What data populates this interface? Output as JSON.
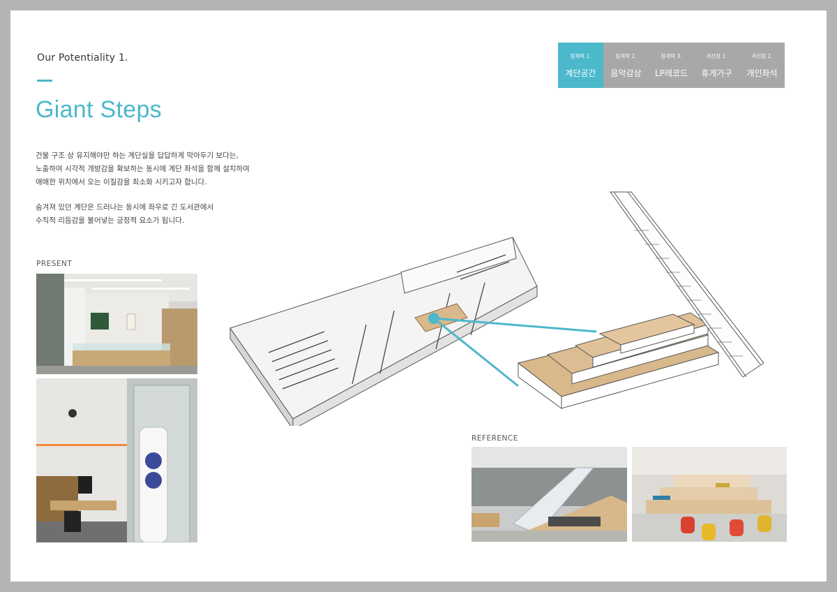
{
  "eyebrow": "Our Potentiality 1.",
  "title": "Giant Steps",
  "description": {
    "paragraph1": [
      "건물 구조 상 유지해야만 하는 계단실을 답답하게 막아두기 보다는,",
      "노출하여 시각적 개방감을 확보하는 동시에 계단 좌석을 함께 설치하여",
      "애매한 위치에서 오는 이질감을 최소화 시키고자 합니다."
    ],
    "paragraph2": [
      "숨겨져 있던 계단은 드러나는 동시에 좌우로 긴 도서관에서",
      "수직적 리듬감을 불어넣는 긍정적 요소가 됩니다."
    ]
  },
  "labels": {
    "present": "PRESENT",
    "reference": "REFERENCE"
  },
  "tabs": [
    {
      "category": "잠재력 1.",
      "name": "계단공간",
      "active": true
    },
    {
      "category": "잠재력 2.",
      "name": "음악감상",
      "active": false
    },
    {
      "category": "잠재력 3.",
      "name": "LP레코드",
      "active": false
    },
    {
      "category": "개선점 1.",
      "name": "휴게가구",
      "active": false
    },
    {
      "category": "개선점 2.",
      "name": "개인좌석",
      "active": false
    }
  ],
  "colors": {
    "accent": "#4bb8cb",
    "tab_inactive": "#a8a8a8",
    "frame": "#b4b4b4",
    "wood": "#d9b88c"
  }
}
